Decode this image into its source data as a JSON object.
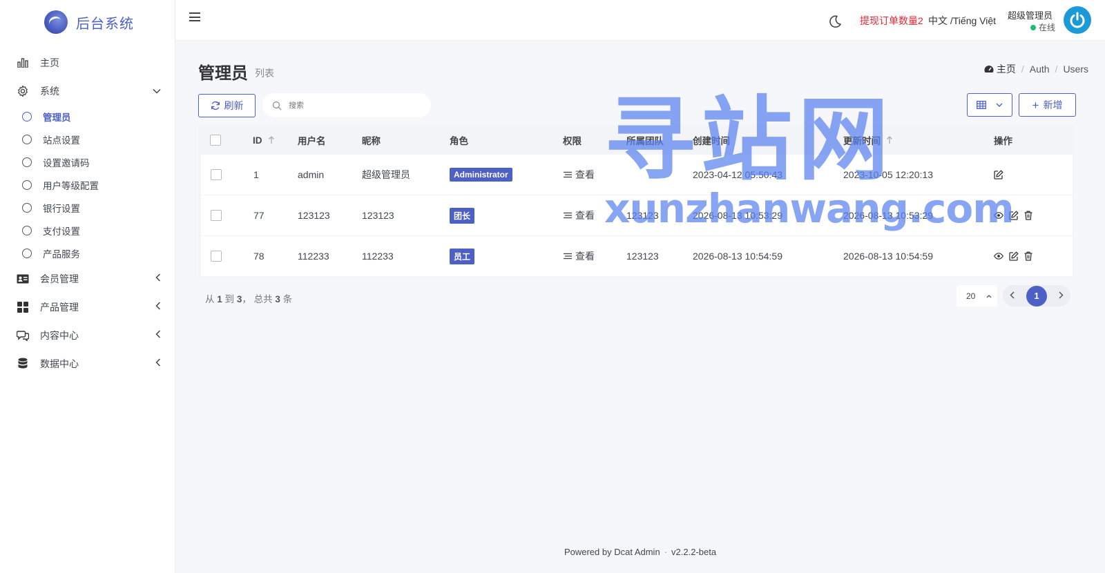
{
  "brand": {
    "title": "后台系统"
  },
  "sidebar": {
    "items": [
      {
        "label": "主页",
        "icon": "bar-chart-icon"
      },
      {
        "label": "系统",
        "icon": "gear-icon",
        "arrow": "down"
      },
      {
        "label": "会员管理",
        "icon": "id-card-icon",
        "arrow": "left"
      },
      {
        "label": "产品管理",
        "icon": "grid-icon",
        "arrow": "left"
      },
      {
        "label": "内容中心",
        "icon": "chat-icon",
        "arrow": "left"
      },
      {
        "label": "数据中心",
        "icon": "database-icon",
        "arrow": "left"
      }
    ],
    "system_children": [
      {
        "label": "管理员",
        "active": true
      },
      {
        "label": "站点设置"
      },
      {
        "label": "设置邀请码"
      },
      {
        "label": "用户等级配置"
      },
      {
        "label": "银行设置"
      },
      {
        "label": "支付设置"
      },
      {
        "label": "产品服务"
      }
    ]
  },
  "header": {
    "withdraw_text": "提现订单数量2",
    "language": "中文 /Tiếng Việt",
    "user_name": "超级管理员",
    "user_status": "在线"
  },
  "page": {
    "title": "管理员",
    "subtitle": "列表",
    "breadcrumb": [
      "主页",
      "Auth",
      "Users"
    ]
  },
  "toolbar": {
    "refresh_label": "刷新",
    "search_placeholder": "搜索",
    "add_label": "新增"
  },
  "table": {
    "headers": [
      "ID",
      "用户名",
      "昵称",
      "角色",
      "权限",
      "所属团队",
      "创建时间",
      "更新时间",
      "操作"
    ],
    "rows": [
      {
        "id": "1",
        "username": "admin",
        "nickname": "超级管理员",
        "role": "Administrator",
        "permission": "查看",
        "team": "",
        "created": "2023-04-12 05:50:43",
        "updated": "2023-10-05 12:20:13",
        "actions": [
          "edit"
        ]
      },
      {
        "id": "77",
        "username": "123123",
        "nickname": "123123",
        "role": "团长",
        "permission": "查看",
        "team": "123123",
        "created": "2026-08-13 10:53:29",
        "updated": "2026-08-13 10:53:29",
        "actions": [
          "view",
          "edit",
          "delete"
        ]
      },
      {
        "id": "78",
        "username": "112233",
        "nickname": "112233",
        "role": "员工",
        "permission": "查看",
        "team": "123123",
        "created": "2026-08-13 10:54:59",
        "updated": "2026-08-13 10:54:59",
        "actions": [
          "view",
          "edit",
          "delete"
        ]
      }
    ]
  },
  "pagination": {
    "summary_from_label": "从",
    "from": "1",
    "to_label": "到",
    "to": "3",
    "total_label": "， 总共",
    "total": "3",
    "unit": "条",
    "per_page": "20",
    "current_page": "1"
  },
  "footer": {
    "powered": "Powered by Dcat Admin",
    "version": "v2.2.2-beta"
  },
  "watermark": {
    "big": "寻站网",
    "small": "xunzhanwang.com"
  },
  "colors": {
    "primary": "#4c60c6",
    "alert": "#e5252f",
    "online": "#21b978"
  }
}
